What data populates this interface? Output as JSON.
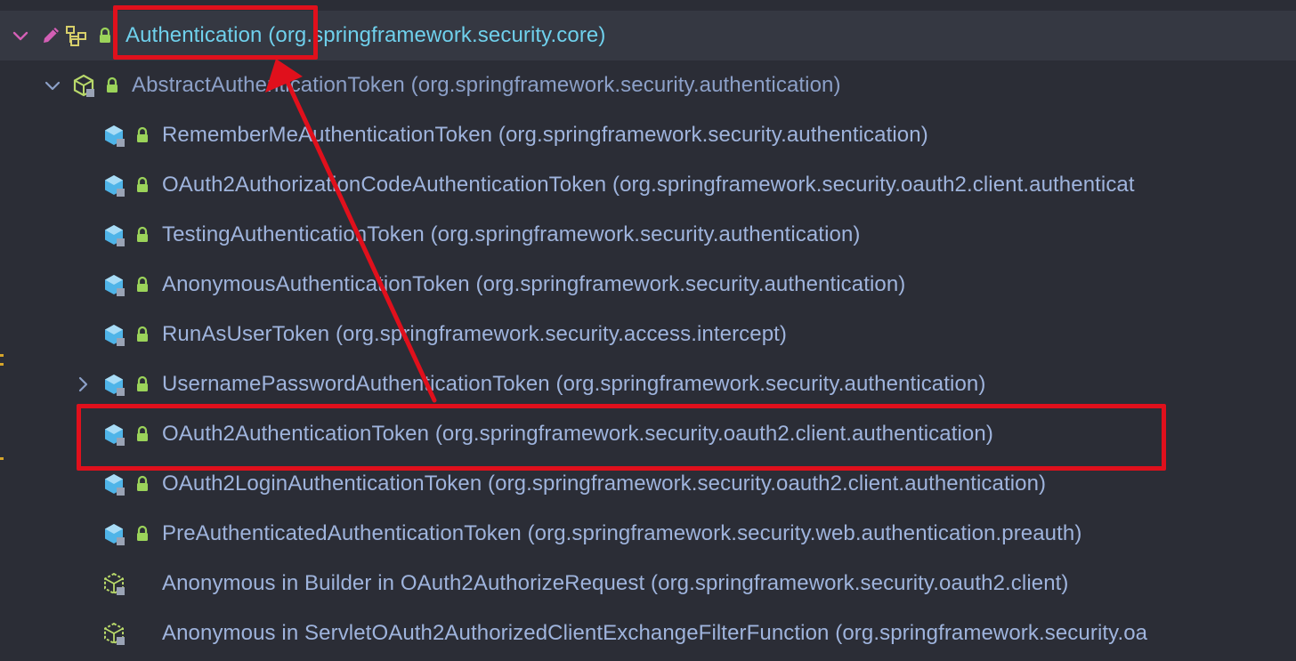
{
  "tree": {
    "root": {
      "class_name": "Authentication",
      "package": "(org.springframework.security.core)",
      "icons": [
        "chevron-down-icon",
        "pencil-icon",
        "hierarchy-icon",
        "lock-icon"
      ]
    },
    "abstract": {
      "class_name": "AbstractAuthenticationToken",
      "package": "(org.springframework.security.authentication)"
    },
    "children": [
      {
        "class_name": "RememberMeAuthenticationToken",
        "package": "(org.springframework.security.authentication)"
      },
      {
        "class_name": "OAuth2AuthorizationCodeAuthenticationToken",
        "package": "(org.springframework.security.oauth2.client.authenticat"
      },
      {
        "class_name": "TestingAuthenticationToken",
        "package": "(org.springframework.security.authentication)"
      },
      {
        "class_name": "AnonymousAuthenticationToken",
        "package": "(org.springframework.security.authentication)"
      },
      {
        "class_name": "RunAsUserToken",
        "package": "(org.springframework.security.access.intercept)"
      },
      {
        "class_name": "UsernamePasswordAuthenticationToken",
        "package": "(org.springframework.security.authentication)"
      },
      {
        "class_name": "OAuth2AuthenticationToken",
        "package": "(org.springframework.security.oauth2.client.authentication)"
      },
      {
        "class_name": "OAuth2LoginAuthenticationToken",
        "package": "(org.springframework.security.oauth2.client.authentication)"
      },
      {
        "class_name": "PreAuthenticatedAuthenticationToken",
        "package": "(org.springframework.security.web.authentication.preauth)"
      }
    ],
    "anonymous": [
      {
        "class_name": "Anonymous in Builder in OAuth2AuthorizeRequest",
        "package": "(org.springframework.security.oauth2.client)"
      },
      {
        "class_name": "Anonymous in ServletOAuth2AuthorizedClientExchangeFilterFunction",
        "package": "(org.springframework.security.oa"
      }
    ]
  },
  "colors": {
    "background": "#2b2d36",
    "selected_row": "#353842",
    "interface_text": "#6fd0ec",
    "class_text": "#9fb4dd",
    "callout_red": "#e0101c",
    "lock_green": "#9bd35a",
    "class_icon_blue": "#4fb4e8"
  }
}
